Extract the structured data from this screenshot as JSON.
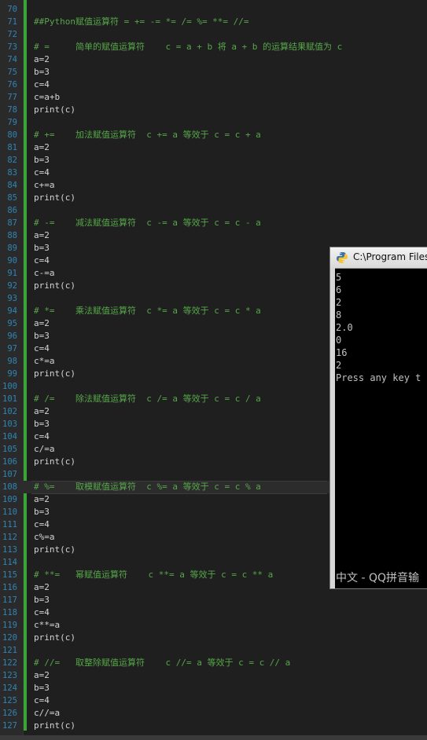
{
  "editor": {
    "lines": [
      {
        "n": "70",
        "text": "",
        "type": "code"
      },
      {
        "n": "71",
        "text": "##Python赋值运算符 = += -= *= /= %= **= //=",
        "type": "comment"
      },
      {
        "n": "72",
        "text": "",
        "type": "code"
      },
      {
        "n": "73",
        "text": "# =     简单的赋值运算符    c = a + b 将 a + b 的运算结果赋值为 c",
        "type": "comment"
      },
      {
        "n": "74",
        "text": "a=2",
        "type": "code"
      },
      {
        "n": "75",
        "text": "b=3",
        "type": "code"
      },
      {
        "n": "76",
        "text": "c=4",
        "type": "code"
      },
      {
        "n": "77",
        "text": "c=a+b",
        "type": "code"
      },
      {
        "n": "78",
        "text": "print(c)",
        "type": "code"
      },
      {
        "n": "79",
        "text": "",
        "type": "code"
      },
      {
        "n": "80",
        "text": "# +=    加法赋值运算符  c += a 等效于 c = c + a",
        "type": "comment"
      },
      {
        "n": "81",
        "text": "a=2",
        "type": "code"
      },
      {
        "n": "82",
        "text": "b=3",
        "type": "code"
      },
      {
        "n": "83",
        "text": "c=4",
        "type": "code"
      },
      {
        "n": "84",
        "text": "c+=a",
        "type": "code"
      },
      {
        "n": "85",
        "text": "print(c)",
        "type": "code"
      },
      {
        "n": "86",
        "text": "",
        "type": "code"
      },
      {
        "n": "87",
        "text": "# -=    减法赋值运算符  c -= a 等效于 c = c - a",
        "type": "comment"
      },
      {
        "n": "88",
        "text": "a=2",
        "type": "code"
      },
      {
        "n": "89",
        "text": "b=3",
        "type": "code"
      },
      {
        "n": "90",
        "text": "c=4",
        "type": "code"
      },
      {
        "n": "91",
        "text": "c-=a",
        "type": "code"
      },
      {
        "n": "92",
        "text": "print(c)",
        "type": "code"
      },
      {
        "n": "93",
        "text": "",
        "type": "code"
      },
      {
        "n": "94",
        "text": "# *=    乘法赋值运算符  c *= a 等效于 c = c * a",
        "type": "comment"
      },
      {
        "n": "95",
        "text": "a=2",
        "type": "code"
      },
      {
        "n": "96",
        "text": "b=3",
        "type": "code"
      },
      {
        "n": "97",
        "text": "c=4",
        "type": "code"
      },
      {
        "n": "98",
        "text": "c*=a",
        "type": "code"
      },
      {
        "n": "99",
        "text": "print(c)",
        "type": "code"
      },
      {
        "n": "100",
        "text": "",
        "type": "code"
      },
      {
        "n": "101",
        "text": "# /=    除法赋值运算符  c /= a 等效于 c = c / a",
        "type": "comment"
      },
      {
        "n": "102",
        "text": "a=2",
        "type": "code"
      },
      {
        "n": "103",
        "text": "b=3",
        "type": "code"
      },
      {
        "n": "104",
        "text": "c=4",
        "type": "code"
      },
      {
        "n": "105",
        "text": "c/=a",
        "type": "code"
      },
      {
        "n": "106",
        "text": "print(c)",
        "type": "code"
      },
      {
        "n": "107",
        "text": "",
        "type": "code"
      },
      {
        "n": "108",
        "text": "# %=    取模赋值运算符  c %= a 等效于 c = c % a",
        "type": "comment",
        "active": true
      },
      {
        "n": "109",
        "text": "a=2",
        "type": "code"
      },
      {
        "n": "110",
        "text": "b=3",
        "type": "code"
      },
      {
        "n": "111",
        "text": "c=4",
        "type": "code"
      },
      {
        "n": "112",
        "text": "c%=a",
        "type": "code"
      },
      {
        "n": "113",
        "text": "print(c)",
        "type": "code"
      },
      {
        "n": "114",
        "text": "",
        "type": "code"
      },
      {
        "n": "115",
        "text": "# **=   幂赋值运算符    c **= a 等效于 c = c ** a",
        "type": "comment"
      },
      {
        "n": "116",
        "text": "a=2",
        "type": "code"
      },
      {
        "n": "117",
        "text": "b=3",
        "type": "code"
      },
      {
        "n": "118",
        "text": "c=4",
        "type": "code"
      },
      {
        "n": "119",
        "text": "c**=a",
        "type": "code"
      },
      {
        "n": "120",
        "text": "print(c)",
        "type": "code"
      },
      {
        "n": "121",
        "text": "",
        "type": "code"
      },
      {
        "n": "122",
        "text": "# //=   取整除赋值运算符    c //= a 等效于 c = c // a",
        "type": "comment"
      },
      {
        "n": "123",
        "text": "a=2",
        "type": "code"
      },
      {
        "n": "124",
        "text": "b=3",
        "type": "code"
      },
      {
        "n": "125",
        "text": "c=4",
        "type": "code"
      },
      {
        "n": "126",
        "text": "c//=a",
        "type": "code"
      },
      {
        "n": "127",
        "text": "print(c)",
        "type": "code"
      }
    ]
  },
  "console": {
    "title": "C:\\Program Files",
    "output": [
      "5",
      "6",
      "2",
      "8",
      "2.0",
      "0",
      "16",
      "2",
      "Press any key t"
    ],
    "ime_text": "中文 - QQ拼音输"
  },
  "colors": {
    "line_number": "#2e86b8",
    "comment": "#57a64a",
    "code": "#d4d4d4",
    "fold_bar": "#3aa537"
  }
}
